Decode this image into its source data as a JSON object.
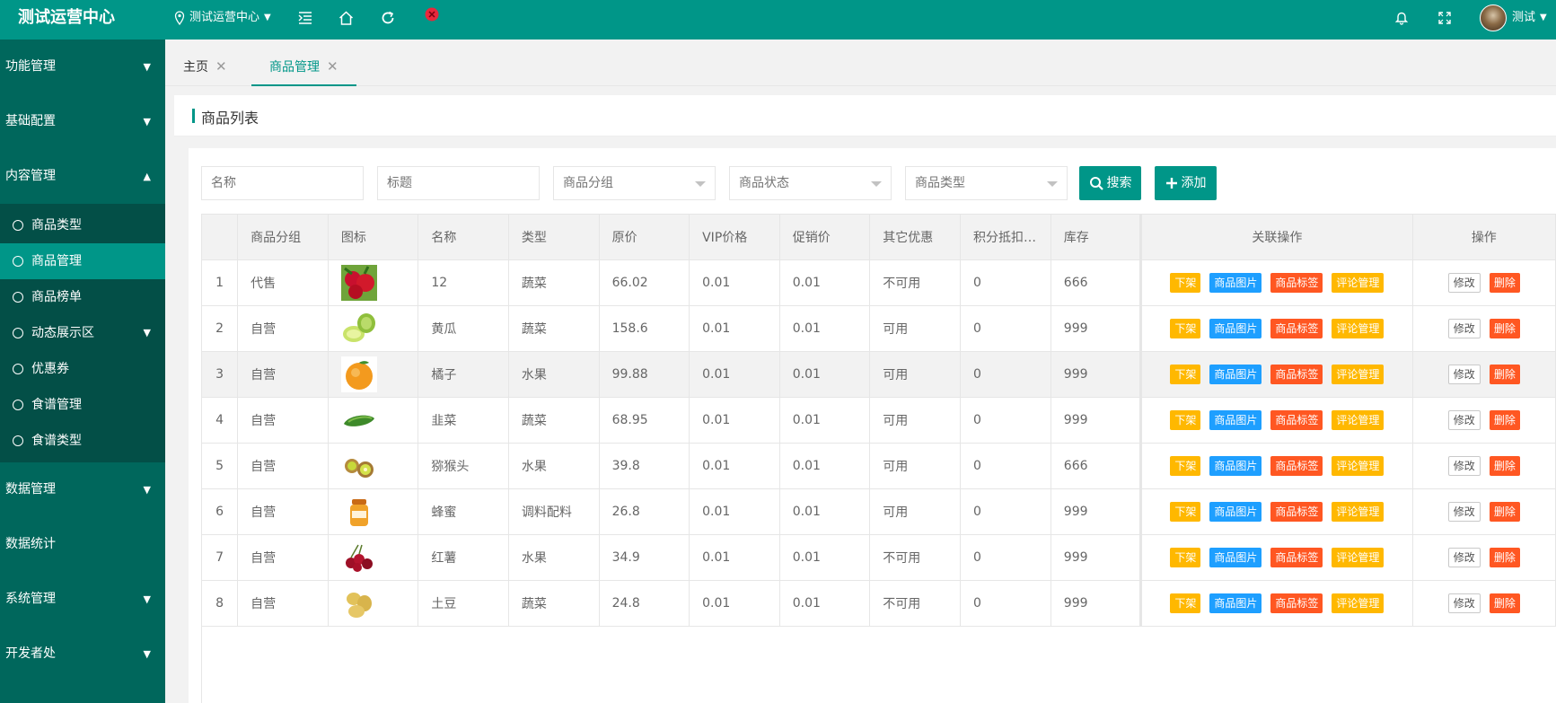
{
  "app": {
    "title": "测试运营中心",
    "location": "测试运营中心",
    "user": "测试"
  },
  "sidebar": {
    "menus_top": [
      "功能管理",
      "基础配置",
      "内容管理"
    ],
    "content_sub": [
      "商品类型",
      "商品管理",
      "商品榜单",
      "动态展示区",
      "优惠券",
      "食谱管理",
      "食谱类型"
    ],
    "menus_bottom": [
      "数据管理",
      "数据统计",
      "系统管理",
      "开发者处"
    ]
  },
  "tabs": [
    "主页",
    "商品管理"
  ],
  "panel": {
    "title": "商品列表"
  },
  "search": {
    "name_placeholder": "名称",
    "title_placeholder": "标题",
    "group_placeholder": "商品分组",
    "status_placeholder": "商品状态",
    "type_placeholder": "商品类型",
    "search_label": "搜索",
    "add_label": "添加"
  },
  "table": {
    "columns": [
      "商品分组",
      "图标",
      "名称",
      "类型",
      "原价",
      "VIP价格",
      "促销价",
      "其它优惠",
      "积分抵扣…",
      "库存",
      "关联操作",
      "操作"
    ],
    "actions": {
      "off": "下架",
      "images": "商品图片",
      "tags": "商品标签",
      "reviews": "评论管理",
      "edit": "修改",
      "delete": "删除"
    },
    "rows": [
      {
        "no": "1",
        "group": "代售",
        "name": "12",
        "type": "蔬菜",
        "price": "66.02",
        "vip": "0.01",
        "promo": "0.01",
        "other": "不可用",
        "points": "0",
        "stock": "666",
        "icon": "strawberry-icon"
      },
      {
        "no": "2",
        "group": "自营",
        "name": "黄瓜",
        "type": "蔬菜",
        "price": "158.6",
        "vip": "0.01",
        "promo": "0.01",
        "other": "可用",
        "points": "0",
        "stock": "999",
        "icon": "melon-icon"
      },
      {
        "no": "3",
        "group": "自营",
        "name": "橘子",
        "type": "水果",
        "price": "99.88",
        "vip": "0.01",
        "promo": "0.01",
        "other": "可用",
        "points": "0",
        "stock": "999",
        "icon": "orange-icon"
      },
      {
        "no": "4",
        "group": "自营",
        "name": "韭菜",
        "type": "蔬菜",
        "price": "68.95",
        "vip": "0.01",
        "promo": "0.01",
        "other": "可用",
        "points": "0",
        "stock": "999",
        "icon": "cucumber-icon"
      },
      {
        "no": "5",
        "group": "自营",
        "name": "猕猴头",
        "type": "水果",
        "price": "39.8",
        "vip": "0.01",
        "promo": "0.01",
        "other": "可用",
        "points": "0",
        "stock": "666",
        "icon": "kiwi-icon"
      },
      {
        "no": "6",
        "group": "自营",
        "name": "蜂蜜",
        "type": "调料配料",
        "price": "26.8",
        "vip": "0.01",
        "promo": "0.01",
        "other": "可用",
        "points": "0",
        "stock": "999",
        "icon": "honey-jar-icon"
      },
      {
        "no": "7",
        "group": "自营",
        "name": "红薯",
        "type": "水果",
        "price": "34.9",
        "vip": "0.01",
        "promo": "0.01",
        "other": "不可用",
        "points": "0",
        "stock": "999",
        "icon": "cherries-icon"
      },
      {
        "no": "8",
        "group": "自营",
        "name": "土豆",
        "type": "蔬菜",
        "price": "24.8",
        "vip": "0.01",
        "promo": "0.01",
        "other": "不可用",
        "points": "0",
        "stock": "999",
        "icon": "potato-icon"
      }
    ]
  },
  "colors": {
    "primary": "#009688",
    "sidebar": "#00675c",
    "warn": "#ffb800",
    "info": "#1e9fff",
    "danger": "#ff5722"
  }
}
